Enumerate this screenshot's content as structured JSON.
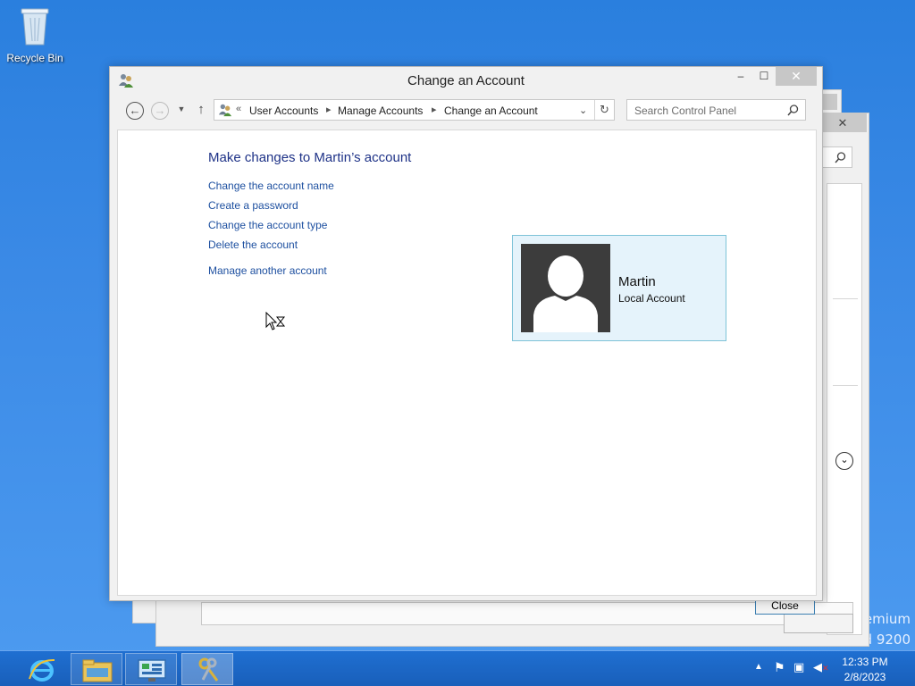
{
  "desktop": {
    "recycle_bin_label": "Recycle Bin",
    "watermark_line1": "emium",
    "watermark_line2": "d 9200"
  },
  "window": {
    "title": "Change an Account",
    "caption": {
      "minimize": "–",
      "maximize": "☐",
      "close": "✕"
    },
    "breadcrumb": {
      "overflow": "«",
      "items": [
        "User Accounts",
        "Manage Accounts",
        "Change an Account"
      ]
    },
    "search": {
      "placeholder": "Search Control Panel"
    },
    "main": {
      "heading": "Make changes to Martin’s account",
      "links": [
        "Change the account name",
        "Create a password",
        "Change the account type",
        "Delete the account"
      ],
      "manage_other": "Manage another account"
    },
    "account_card": {
      "name": "Martin",
      "type": "Local Account"
    }
  },
  "background_dialog": {
    "close_button": "Close",
    "close_icon": "✕"
  },
  "taskbar": {
    "clock": {
      "time": "12:33 PM",
      "date": "2/8/2023"
    },
    "icons": [
      "internet-explorer-icon",
      "file-explorer-icon",
      "control-panel-icon",
      "user-accounts-icon"
    ],
    "accent": "#1f6fd1"
  }
}
